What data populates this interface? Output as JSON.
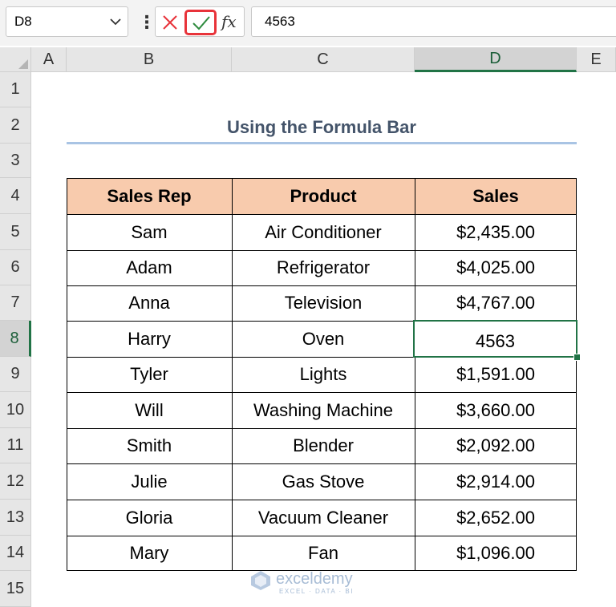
{
  "formula_bar": {
    "name_box": "D8",
    "formula": "4563",
    "fx_label": "fx",
    "separator": "⋮"
  },
  "columns": [
    "A",
    "B",
    "C",
    "D",
    "E"
  ],
  "rows": [
    "1",
    "2",
    "3",
    "4",
    "5",
    "6",
    "7",
    "8",
    "9",
    "10",
    "11",
    "12",
    "13",
    "14",
    "15"
  ],
  "sheet": {
    "title": "Using the Formula Bar",
    "headers": [
      "Sales Rep",
      "Product",
      "Sales"
    ],
    "records": [
      [
        "Sam",
        "Air Conditioner",
        "$2,435.00"
      ],
      [
        "Adam",
        "Refrigerator",
        "$4,025.00"
      ],
      [
        "Anna",
        "Television",
        "$4,767.00"
      ],
      [
        "Harry",
        "Oven",
        "4563"
      ],
      [
        "Tyler",
        "Lights",
        "$1,591.00"
      ],
      [
        "Will",
        "Washing Machine",
        "$3,660.00"
      ],
      [
        "Smith",
        "Blender",
        "$2,092.00"
      ],
      [
        "Julie",
        "Gas Stove",
        "$2,914.00"
      ],
      [
        "Gloria",
        "Vacuum Cleaner",
        "$2,652.00"
      ],
      [
        "Mary",
        "Fan",
        "$1,096.00"
      ]
    ]
  },
  "watermark": {
    "name": "exceldemy",
    "tagline": "EXCEL · DATA · BI"
  },
  "colors": {
    "accent_green": "#217346",
    "header_fill": "#f8cbad",
    "title_color": "#44546a",
    "enter_highlight": "#e8333a"
  }
}
